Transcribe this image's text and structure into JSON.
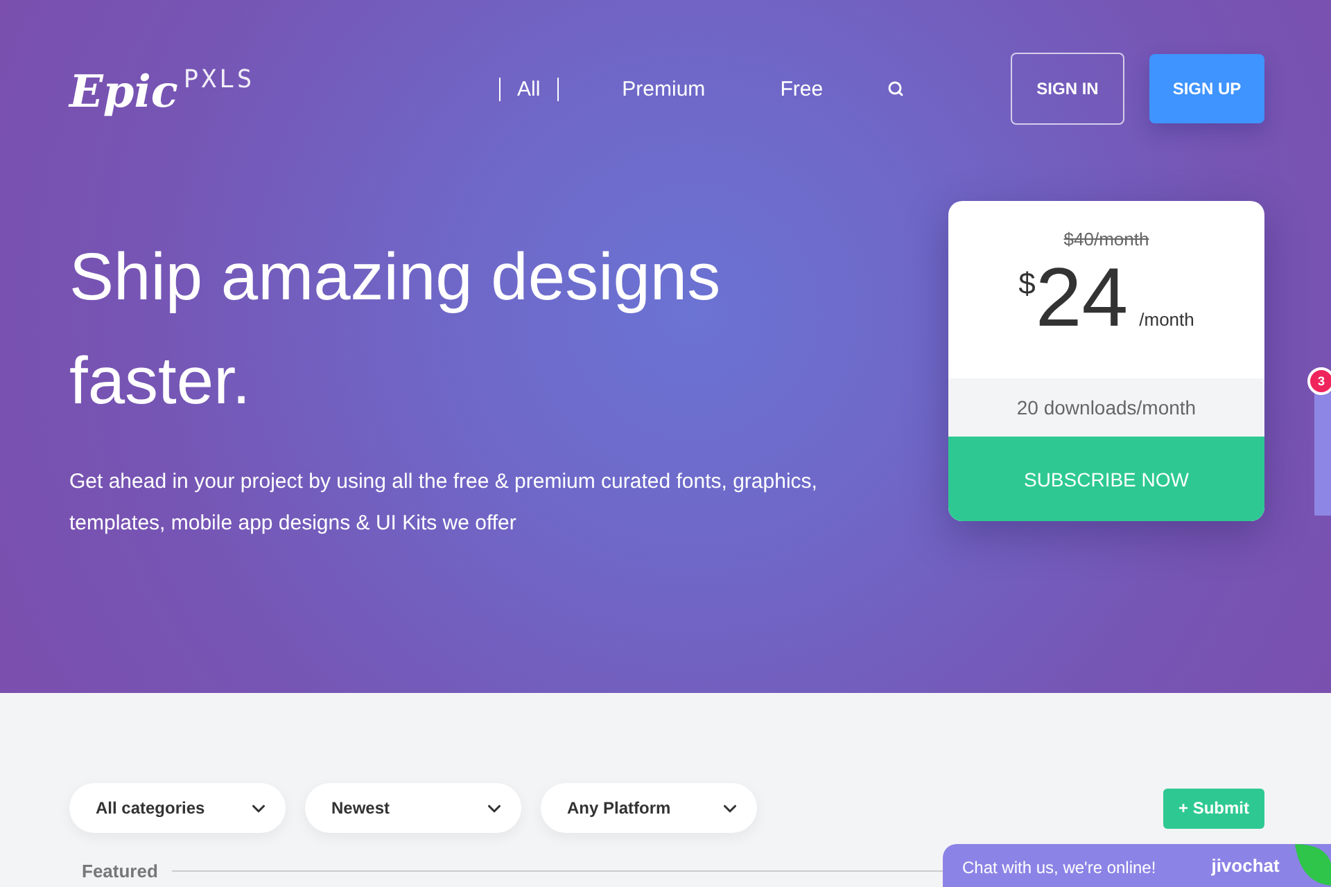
{
  "logo": {
    "script": "Epic",
    "pixel": "PXLS"
  },
  "nav": [
    {
      "label": "All",
      "selected": true
    },
    {
      "label": "Premium",
      "selected": false
    },
    {
      "label": "Free",
      "selected": false
    }
  ],
  "auth": {
    "sign_in": "SIGN IN",
    "sign_up": "SIGN UP"
  },
  "hero": {
    "headline": "Ship amazing designs faster.",
    "description": "Get ahead in your project by using all the free & premium curated fonts, graphics, templates, mobile app designs & UI Kits we offer"
  },
  "pricing": {
    "old_price": "$40/month",
    "currency": "$",
    "price": "24",
    "period": "/month",
    "feature": "20 downloads/month",
    "cta": "SUBSCRIBE NOW"
  },
  "side_tab": {
    "badge": "3"
  },
  "filters": [
    {
      "label": "All categories"
    },
    {
      "label": "Newest"
    },
    {
      "label": "Any Platform"
    }
  ],
  "submit": "+ Submit",
  "section_title": "Featured",
  "chat": {
    "message": "Chat with us, we're online!",
    "brand": "jivochat"
  }
}
